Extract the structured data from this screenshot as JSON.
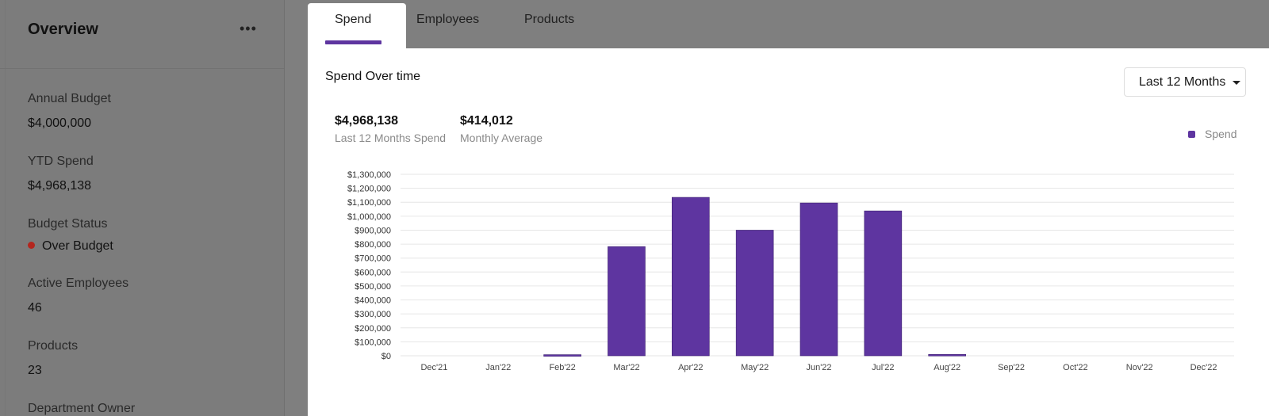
{
  "sidebar": {
    "title": "Overview",
    "more_label": "•••",
    "items": [
      {
        "label": "Annual Budget",
        "value": "$4,000,000"
      },
      {
        "label": "YTD Spend",
        "value": "$4,968,138"
      },
      {
        "label": "Budget Status",
        "value": "Over Budget",
        "status_color": "#b3261e"
      },
      {
        "label": "Active Employees",
        "value": "46"
      },
      {
        "label": "Products",
        "value": "23"
      },
      {
        "label": "Department Owner",
        "value": ""
      }
    ]
  },
  "tabs": [
    {
      "label": "Spend",
      "active": true
    },
    {
      "label": "Employees",
      "active": false
    },
    {
      "label": "Products",
      "active": false
    }
  ],
  "panel": {
    "title": "Spend Over time",
    "range_select": {
      "selected": "Last 12 Months"
    },
    "stats": [
      {
        "value": "$4,968,138",
        "label": "Last 12 Months Spend"
      },
      {
        "value": "$414,012",
        "label": "Monthly Average"
      }
    ]
  },
  "colors": {
    "accent": "#5e35a0",
    "bar": "#5e35a0"
  },
  "chart_data": {
    "type": "bar",
    "categories": [
      "Dec'21",
      "Jan'22",
      "Feb'22",
      "Mar'22",
      "Apr'22",
      "May'22",
      "Jun'22",
      "Jul'22",
      "Aug'22",
      "Sep'22",
      "Oct'22",
      "Nov'22",
      "Dec'22"
    ],
    "series": [
      {
        "name": "Spend",
        "values": [
          0,
          0,
          8000,
          782000,
          1135000,
          900000,
          1095000,
          1038000,
          10000,
          0,
          0,
          0,
          0
        ]
      }
    ],
    "y_ticks": [
      "$0",
      "$100,000",
      "$200,000",
      "$300,000",
      "$400,000",
      "$500,000",
      "$600,000",
      "$700,000",
      "$800,000",
      "$900,000",
      "$1,000,000",
      "$1,100,000",
      "$1,200,000",
      "$1,300,000"
    ],
    "ylim": [
      0,
      1300000
    ],
    "grid": true,
    "legend_position": "top-right"
  }
}
